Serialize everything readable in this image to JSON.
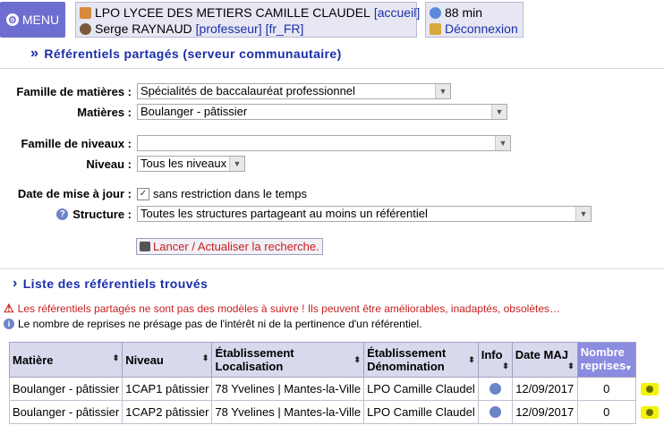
{
  "header": {
    "menu_label": "MENU",
    "school_name": "LPO LYCEE DES METIERS CAMILLE CLAUDEL",
    "school_link": "[accueil]",
    "user_name": "Serge RAYNAUD",
    "user_role": "[professeur]",
    "user_locale": "[fr_FR]",
    "session_time": "88 min",
    "logout_label": "Déconnexion"
  },
  "page": {
    "title": "Référentiels partagés (serveur communautaire)"
  },
  "form": {
    "famille_matieres_label": "Famille de matières :",
    "famille_matieres_value": "Spécialités de baccalauréat professionnel",
    "matieres_label": "Matières :",
    "matieres_value": "Boulanger - pâtissier",
    "famille_niveaux_label": "Famille de niveaux :",
    "famille_niveaux_value": "",
    "niveau_label": "Niveau :",
    "niveau_value": "Tous les niveaux",
    "date_label": "Date de mise à jour :",
    "date_checkbox_label": "sans restriction dans le temps",
    "structure_label": "Structure :",
    "structure_value": "Toutes les structures partageant au moins un référentiel",
    "search_button": "Lancer / Actualiser la recherche."
  },
  "results": {
    "title": "Liste des référentiels trouvés",
    "warning": "Les référentiels partagés ne sont pas des modèles à suivre ! Ils peuvent être améliorables, inadaptés, obsolètes…",
    "note": "Le nombre de reprises ne présage pas de l'intérêt ni de la pertinence d'un référentiel.",
    "columns": {
      "matiere": "Matière",
      "niveau": "Niveau",
      "etab_loc_1": "Établissement",
      "etab_loc_2": "Localisation",
      "etab_den_1": "Établissement",
      "etab_den_2": "Dénomination",
      "info": "Info",
      "date": "Date MAJ",
      "reprises_1": "Nombre",
      "reprises_2": "reprises"
    },
    "rows": [
      {
        "matiere": "Boulanger - pâtissier",
        "niveau": "1CAP1 pâtissier",
        "localisation": "78 Yvelines | Mantes-la-Ville",
        "denomination": "LPO Camille Claudel",
        "date": "12/09/2017",
        "reprises": "0"
      },
      {
        "matiere": "Boulanger - pâtissier",
        "niveau": "1CAP2 pâtissier",
        "localisation": "78 Yvelines | Mantes-la-Ville",
        "denomination": "LPO Camille Claudel",
        "date": "12/09/2017",
        "reprises": "0"
      }
    ]
  },
  "colors": {
    "accent": "#1a2ea8",
    "menu_bg": "#6e6ed0",
    "warning_text": "#c62020",
    "eye_highlight": "#f4f20a"
  }
}
